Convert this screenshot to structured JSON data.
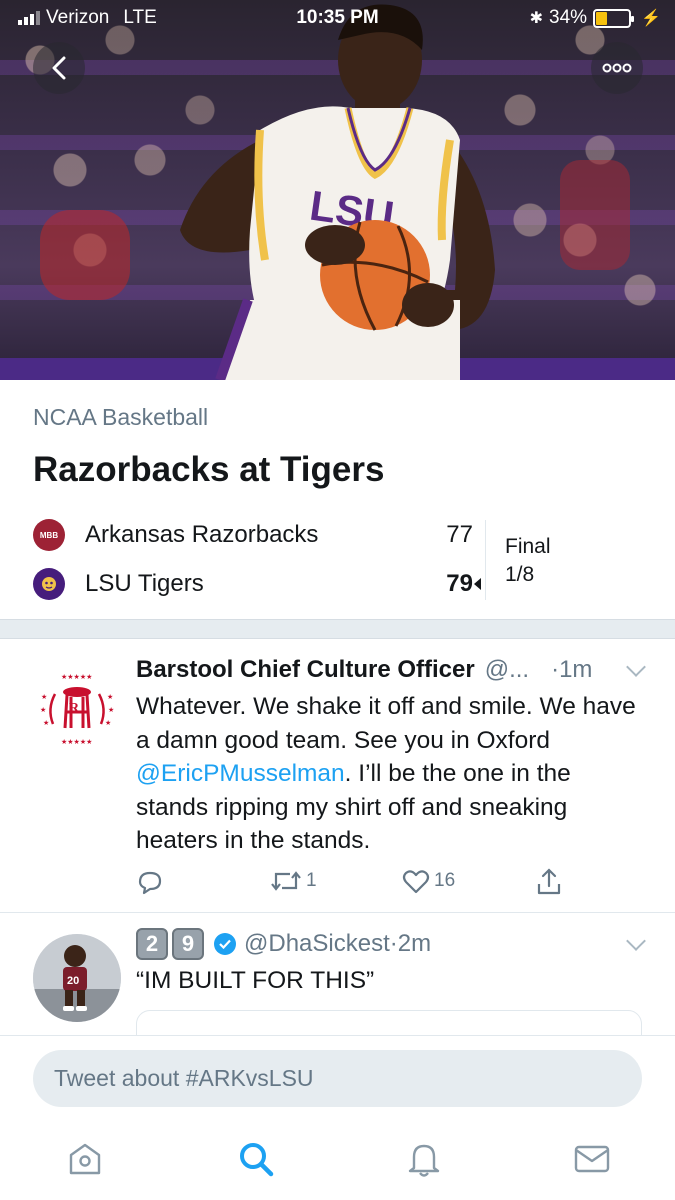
{
  "status_bar": {
    "carrier": "Verizon",
    "network": "LTE",
    "time": "10:35 PM",
    "battery_percent": "34%",
    "battery_level": 0.34
  },
  "hero": {
    "back_icon": "chevron-left-icon",
    "more_icon": "more-dots-icon",
    "jersey_text": "LSU"
  },
  "game": {
    "league": "NCAA Basketball",
    "title": "Razorbacks at Tigers",
    "teams": [
      {
        "name": "Arkansas Razorbacks",
        "score": "77",
        "logo_text": "MBB",
        "color": "#9d2235"
      },
      {
        "name": "LSU Tigers",
        "score": "79",
        "color": "#461d7c"
      }
    ],
    "status": "Final",
    "date": "1/8"
  },
  "tweets": [
    {
      "display_name": "Barstool Chief Culture Officer",
      "handle": "@...",
      "time": "·1m",
      "text_before": "Whatever. We shake it off and smile. We have a damn good team. See you in Oxford ",
      "mention": "@EricPMusselman",
      "text_after": ". I’ll be the one in the stands ripping my shirt off and sneaking heaters in the stands.",
      "retweets": "1",
      "likes": "16",
      "avatar_stars": "★★★★★★★★★★★★★★★★"
    },
    {
      "badges": [
        "2",
        "9"
      ],
      "handle": "@DhaSickest",
      "time": "·2m",
      "text": "“IM BUILT FOR THIS”",
      "avatar_jersey": "20"
    }
  ],
  "compose": {
    "placeholder": "Tweet about #ARKvsLSU"
  },
  "tabs": [
    {
      "name": "home-icon"
    },
    {
      "name": "search-icon"
    },
    {
      "name": "notifications-icon"
    },
    {
      "name": "messages-icon"
    }
  ],
  "colors": {
    "accent": "#1da1f2",
    "text": "#14171a",
    "muted": "#657786",
    "divider": "#e1e8ed"
  }
}
